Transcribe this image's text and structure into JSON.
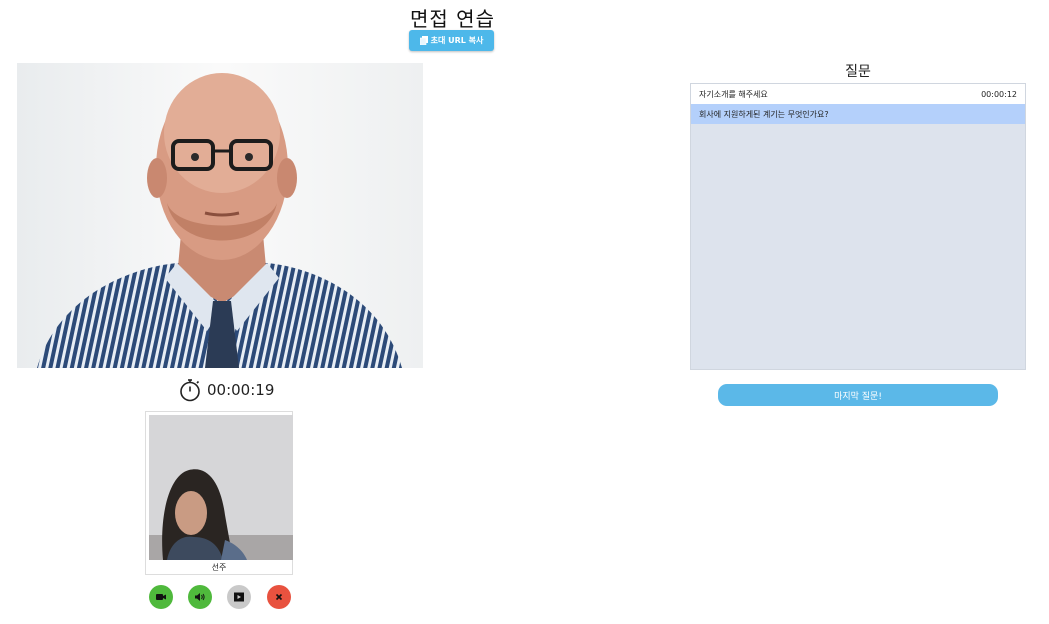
{
  "header": {
    "title": "면접 연습",
    "copy_button_label": "초대 URL 복사"
  },
  "interviewer": {
    "timer": "00:00:19"
  },
  "self_view": {
    "name": "선주"
  },
  "controls": [
    {
      "name": "camera",
      "icon": "video-camera-icon",
      "color": "#4fb93c"
    },
    {
      "name": "audio",
      "icon": "speaker-icon",
      "color": "#4fb93c"
    },
    {
      "name": "screen",
      "icon": "screen-share-icon",
      "color": "#c9c9c9"
    },
    {
      "name": "leave",
      "icon": "close-icon",
      "color": "#e8523f"
    }
  ],
  "questions": {
    "title": "질문",
    "items": [
      {
        "text": "자기소개를 해주세요",
        "time": "00:00:12"
      },
      {
        "text": "회사에 지원하게된 계기는 무엇인가요?",
        "time": ""
      }
    ],
    "last_button_label": "마지막 질문!"
  },
  "colors": {
    "accent": "#4db8ea",
    "panel": "#dde3ed",
    "active_row": "#b4d0fb"
  }
}
